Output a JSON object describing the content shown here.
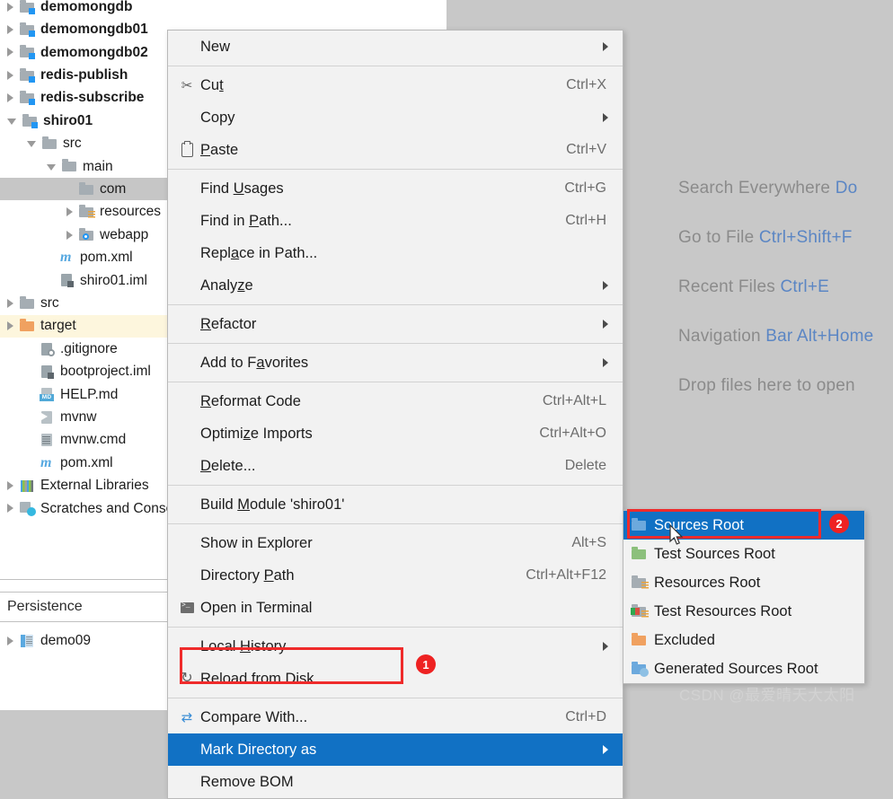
{
  "editor": {
    "hints": [
      {
        "text": "Search Everywhere ",
        "key": "Do"
      },
      {
        "text": "Go to File ",
        "key": "Ctrl+Shift+F"
      },
      {
        "text": "Recent Files ",
        "key": "Ctrl+E"
      },
      {
        "text": "Navigation ",
        "key": "Bar Alt+Home"
      },
      {
        "text": "Drop files here to open",
        "key": ""
      }
    ],
    "play_button": "play-button"
  },
  "project_tree": {
    "items": [
      {
        "label": "demomongdb",
        "indent": 0,
        "arrow": "right",
        "icon": "module-folder",
        "bold": true,
        "selected": "none"
      },
      {
        "label": "demomongdb01",
        "indent": 0,
        "arrow": "right",
        "icon": "module-folder",
        "bold": true,
        "selected": "none"
      },
      {
        "label": "demomongdb02",
        "indent": 0,
        "arrow": "right",
        "icon": "module-folder",
        "bold": true,
        "selected": "none"
      },
      {
        "label": "redis-publish",
        "indent": 0,
        "arrow": "right",
        "icon": "module-folder",
        "bold": true,
        "selected": "none"
      },
      {
        "label": "redis-subscribe",
        "indent": 0,
        "arrow": "right",
        "icon": "module-folder",
        "bold": true,
        "selected": "none"
      },
      {
        "label": "shiro01",
        "indent": 0,
        "arrow": "down",
        "icon": "module-folder",
        "bold": true,
        "selected": "none"
      },
      {
        "label": "src",
        "indent": 1,
        "arrow": "down",
        "icon": "folder-gray",
        "bold": false,
        "selected": "none"
      },
      {
        "label": "main",
        "indent": 2,
        "arrow": "down",
        "icon": "folder-gray",
        "bold": false,
        "selected": "none"
      },
      {
        "label": "com",
        "indent": 3,
        "arrow": "none",
        "icon": "folder-gray",
        "bold": false,
        "selected": "gray"
      },
      {
        "label": "resources",
        "indent": 3,
        "arrow": "right",
        "icon": "folder-resource",
        "bold": false,
        "selected": "none"
      },
      {
        "label": "webapp",
        "indent": 3,
        "arrow": "right",
        "icon": "folder-web",
        "bold": false,
        "selected": "none"
      },
      {
        "label": "pom.xml",
        "indent": 2,
        "arrow": "none",
        "icon": "maven-file",
        "bold": false,
        "selected": "none"
      },
      {
        "label": "shiro01.iml",
        "indent": 2,
        "arrow": "none",
        "icon": "iml-file",
        "bold": false,
        "selected": "none"
      },
      {
        "label": "src",
        "indent": 0,
        "arrow": "right",
        "icon": "folder-gray",
        "bold": false,
        "selected": "none"
      },
      {
        "label": "target",
        "indent": 0,
        "arrow": "right",
        "icon": "folder-orange",
        "bold": false,
        "selected": "yellow"
      },
      {
        "label": ".gitignore",
        "indent": 1,
        "arrow": "none",
        "icon": "gitignore-file",
        "bold": false,
        "selected": "none"
      },
      {
        "label": "bootproject.iml",
        "indent": 1,
        "arrow": "none",
        "icon": "iml-file",
        "bold": false,
        "selected": "none"
      },
      {
        "label": "HELP.md",
        "indent": 1,
        "arrow": "none",
        "icon": "md-file",
        "bold": false,
        "selected": "none"
      },
      {
        "label": "mvnw",
        "indent": 1,
        "arrow": "none",
        "icon": "script-file",
        "bold": false,
        "selected": "none"
      },
      {
        "label": "mvnw.cmd",
        "indent": 1,
        "arrow": "none",
        "icon": "text-file",
        "bold": false,
        "selected": "none"
      },
      {
        "label": "pom.xml",
        "indent": 1,
        "arrow": "none",
        "icon": "maven-file",
        "bold": false,
        "selected": "none"
      },
      {
        "label": "External Libraries",
        "indent": 0,
        "arrow": "right",
        "icon": "libraries-icon",
        "bold": false,
        "selected": "none"
      },
      {
        "label": "Scratches and Consoles",
        "indent": 0,
        "arrow": "right",
        "icon": "scratches-icon",
        "bold": false,
        "selected": "none"
      }
    ],
    "section_header": "Persistence",
    "persistence_items": [
      {
        "label": "demo09",
        "arrow": "right",
        "icon": "database-icon"
      }
    ]
  },
  "context_menu": {
    "items": [
      {
        "label": "New",
        "accel": "",
        "submenu": true,
        "icon": "",
        "highlight": false,
        "mnemonic": ""
      },
      {
        "sep": true
      },
      {
        "label": "Cut",
        "accel": "Ctrl+X",
        "submenu": false,
        "icon": "scissors",
        "highlight": false,
        "mnemonic": "t"
      },
      {
        "label": "Copy",
        "accel": "",
        "submenu": true,
        "icon": "",
        "highlight": false,
        "mnemonic": ""
      },
      {
        "label": "Paste",
        "accel": "Ctrl+V",
        "submenu": false,
        "icon": "clipboard",
        "highlight": false,
        "mnemonic": "P"
      },
      {
        "sep": true
      },
      {
        "label": "Find Usages",
        "accel": "Ctrl+G",
        "submenu": false,
        "icon": "",
        "highlight": false,
        "mnemonic": "U"
      },
      {
        "label": "Find in Path...",
        "accel": "Ctrl+H",
        "submenu": false,
        "icon": "",
        "highlight": false,
        "mnemonic": "P"
      },
      {
        "label": "Replace in Path...",
        "accel": "",
        "submenu": false,
        "icon": "",
        "highlight": false,
        "mnemonic": "a"
      },
      {
        "label": "Analyze",
        "accel": "",
        "submenu": true,
        "icon": "",
        "highlight": false,
        "mnemonic": "z"
      },
      {
        "sep": true
      },
      {
        "label": "Refactor",
        "accel": "",
        "submenu": true,
        "icon": "",
        "highlight": false,
        "mnemonic": "R"
      },
      {
        "sep": true
      },
      {
        "label": "Add to Favorites",
        "accel": "",
        "submenu": true,
        "icon": "",
        "highlight": false,
        "mnemonic": "a"
      },
      {
        "sep": true
      },
      {
        "label": "Reformat Code",
        "accel": "Ctrl+Alt+L",
        "submenu": false,
        "icon": "",
        "highlight": false,
        "mnemonic": "R"
      },
      {
        "label": "Optimize Imports",
        "accel": "Ctrl+Alt+O",
        "submenu": false,
        "icon": "",
        "highlight": false,
        "mnemonic": "z"
      },
      {
        "label": "Delete...",
        "accel": "Delete",
        "submenu": false,
        "icon": "",
        "highlight": false,
        "mnemonic": "D"
      },
      {
        "sep": true
      },
      {
        "label": "Build Module 'shiro01'",
        "accel": "",
        "submenu": false,
        "icon": "",
        "highlight": false,
        "mnemonic": "M"
      },
      {
        "sep": true
      },
      {
        "label": "Show in Explorer",
        "accel": "Alt+S",
        "submenu": false,
        "icon": "",
        "highlight": false,
        "mnemonic": ""
      },
      {
        "label": "Directory Path",
        "accel": "Ctrl+Alt+F12",
        "submenu": false,
        "icon": "",
        "highlight": false,
        "mnemonic": "P"
      },
      {
        "label": "Open in Terminal",
        "accel": "",
        "submenu": false,
        "icon": "terminal",
        "highlight": false,
        "mnemonic": ""
      },
      {
        "sep": true
      },
      {
        "label": "Local History",
        "accel": "",
        "submenu": true,
        "icon": "",
        "highlight": false,
        "mnemonic": "H"
      },
      {
        "label": "Reload from Disk",
        "accel": "",
        "submenu": false,
        "icon": "reload",
        "highlight": false,
        "mnemonic": ""
      },
      {
        "sep": true
      },
      {
        "label": "Compare With...",
        "accel": "Ctrl+D",
        "submenu": false,
        "icon": "compare",
        "highlight": false,
        "mnemonic": ""
      },
      {
        "label": "Mark Directory as",
        "accel": "",
        "submenu": true,
        "icon": "",
        "highlight": true,
        "mnemonic": ""
      },
      {
        "label": "Remove BOM",
        "accel": "",
        "submenu": false,
        "icon": "",
        "highlight": false,
        "mnemonic": ""
      }
    ]
  },
  "submenu": {
    "items": [
      {
        "label": "Sources Root",
        "icon": "folder-blue",
        "highlight": true
      },
      {
        "label": "Test Sources Root",
        "icon": "folder-green",
        "highlight": false
      },
      {
        "label": "Resources Root",
        "icon": "folder-resource",
        "highlight": false
      },
      {
        "label": "Test Resources Root",
        "icon": "folder-test-res",
        "highlight": false
      },
      {
        "label": "Excluded",
        "icon": "folder-orange",
        "highlight": false
      },
      {
        "label": "Generated Sources Root",
        "icon": "folder-generated",
        "highlight": false
      }
    ]
  },
  "annotations": {
    "badges": [
      "1",
      "2"
    ]
  },
  "watermark": "CSDN @最爱晴天大太阳",
  "colors": {
    "menu_bg": "#f2f2f2",
    "highlight_blue": "#1171c4",
    "annotation_red": "#ee2222",
    "editor_bg": "#c8c8c8",
    "tree_selected_gray": "#c6c6c6",
    "tree_selected_yellow": "#fdf6dd"
  }
}
